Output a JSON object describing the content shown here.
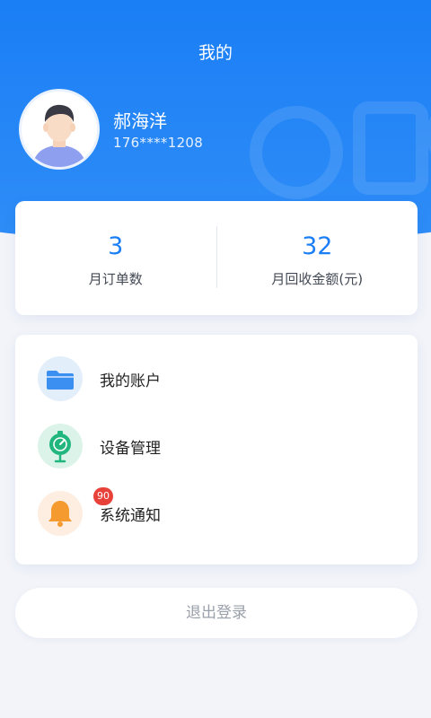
{
  "header": {
    "title": "我的",
    "bg_color": "#1a7ef5"
  },
  "user": {
    "name": "郝海洋",
    "phone": "176****1208",
    "avatar_icon": "user-avatar"
  },
  "stats": [
    {
      "value": "3",
      "label": "月订单数"
    },
    {
      "value": "32",
      "label": "月回收金额(元)"
    }
  ],
  "menu": [
    {
      "label": "我的账户",
      "icon": "folder-icon",
      "color": "#3b8ff0"
    },
    {
      "label": "设备管理",
      "icon": "device-icon",
      "color": "#21b67e"
    },
    {
      "label": "系统通知",
      "icon": "bell-icon",
      "color": "#f59a2e",
      "badge": "90"
    }
  ],
  "logout": {
    "label": "退出登录"
  },
  "colors": {
    "accent": "#1a7ef5",
    "badge": "#e8413a"
  }
}
